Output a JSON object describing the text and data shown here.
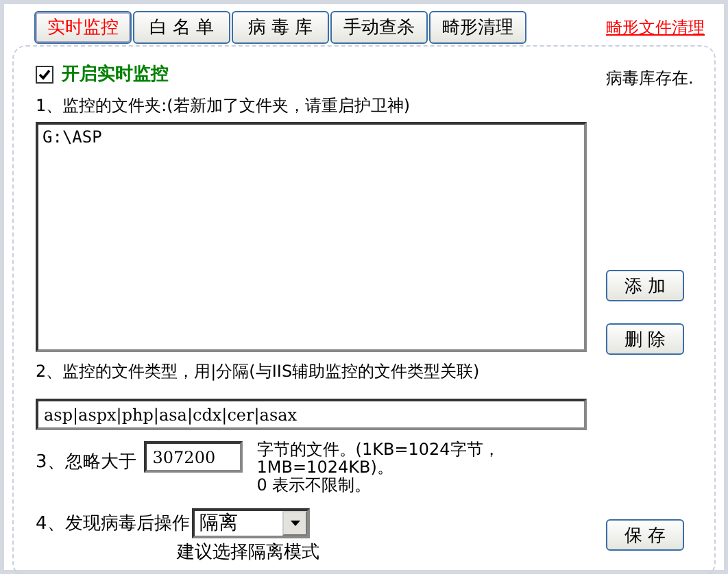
{
  "tabs": [
    {
      "label": "实时监控",
      "selected": true
    },
    {
      "label": "白 名 单",
      "selected": false
    },
    {
      "label": "病 毒 库",
      "selected": false
    },
    {
      "label": "手动查杀",
      "selected": false
    },
    {
      "label": "畸形清理",
      "selected": false
    }
  ],
  "top_link": "畸形文件清理",
  "realtime_checkbox": {
    "label": "开启实时监控",
    "checked": true
  },
  "status_text": "病毒库存在.",
  "folders": {
    "label": "1、监控的文件夹:(若新加了文件夹，请重启护卫神)",
    "items": [
      "G:\\ASP"
    ]
  },
  "buttons": {
    "add": "添 加",
    "delete": "删 除",
    "save": "保 存"
  },
  "file_types": {
    "label": "2、监控的文件类型，用|分隔(与IIS辅助监控的文件类型关联)",
    "value": "asp|aspx|php|asa|cdx|cer|asax"
  },
  "ignore_size": {
    "label": "3、忽略大于",
    "value": "307200",
    "note_1": "字节的文件。(1KB=1024字节，1MB=1024KB)。",
    "note_2": "0 表示不限制。"
  },
  "action": {
    "label": "4、发现病毒后操作",
    "value": "隔离",
    "hint": "建议选择隔离模式"
  }
}
